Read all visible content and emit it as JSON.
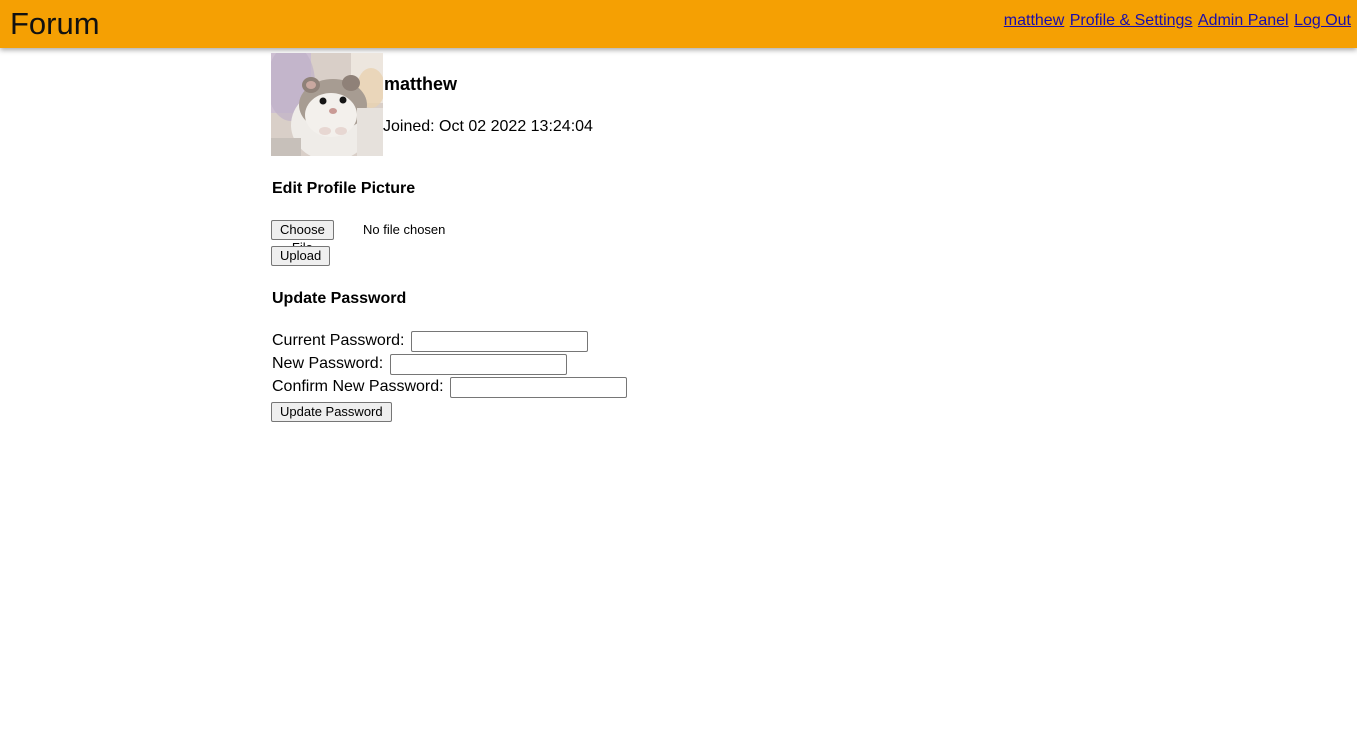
{
  "header": {
    "brand": "Forum",
    "nav": {
      "user": "matthew",
      "profile_settings": "Profile & Settings",
      "admin_panel": "Admin Panel",
      "logout": "Log Out"
    }
  },
  "profile": {
    "username": "matthew",
    "joined": "Joined: Oct 02 2022 13:24:04"
  },
  "picture_section": {
    "title": "Edit Profile Picture",
    "choose_file_label": "Choose File",
    "file_status": "No file chosen",
    "upload_label": "Upload"
  },
  "password_section": {
    "title": "Update Password",
    "current_label": "Current Password:",
    "current_value": "",
    "new_label": "New Password:",
    "new_value": "",
    "confirm_label": "Confirm New Password:",
    "confirm_value": "",
    "submit_label": "Update Password"
  },
  "colors": {
    "header_bg": "#f5a003",
    "link": "#1a0dab"
  }
}
